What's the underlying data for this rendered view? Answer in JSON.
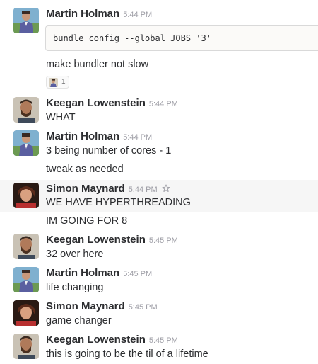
{
  "messages": [
    {
      "sender": "Martin Holman",
      "time": "5:44 PM",
      "avatar": "martin-avatar",
      "code": "bundle config --global JOBS '3'",
      "lines": [
        "make bundler not slow"
      ],
      "reaction": {
        "avatar": "martin-avatar",
        "count": "1"
      }
    },
    {
      "sender": "Keegan Lowenstein",
      "time": "5:44 PM",
      "avatar": "keegan-avatar",
      "lines": [
        "WHAT"
      ]
    },
    {
      "sender": "Martin Holman",
      "time": "5:44 PM",
      "avatar": "martin-avatar",
      "lines": [
        "3 being number of cores - 1",
        "tweak as needed"
      ]
    },
    {
      "sender": "Simon Maynard",
      "time": "5:44 PM",
      "avatar": "simon-avatar",
      "star_icon": "star-icon",
      "lines": [
        "WE HAVE HYPERTHREADING",
        "IM GOING FOR 8"
      ]
    },
    {
      "sender": "Keegan Lowenstein",
      "time": "5:45 PM",
      "avatar": "keegan-avatar",
      "lines": [
        "32 over here"
      ]
    },
    {
      "sender": "Martin Holman",
      "time": "5:45 PM",
      "avatar": "martin-avatar",
      "lines": [
        "life changing"
      ]
    },
    {
      "sender": "Simon Maynard",
      "time": "5:45 PM",
      "avatar": "simon-avatar",
      "lines": [
        "game changer"
      ]
    },
    {
      "sender": "Keegan Lowenstein",
      "time": "5:45 PM",
      "avatar": "keegan-avatar",
      "lines": [
        "this is going to be the til of a lifetime"
      ]
    }
  ],
  "colors": {
    "hover_background": "#f6f6f6",
    "timestamp": "#9e9ea6",
    "text": "#2c2d30"
  }
}
